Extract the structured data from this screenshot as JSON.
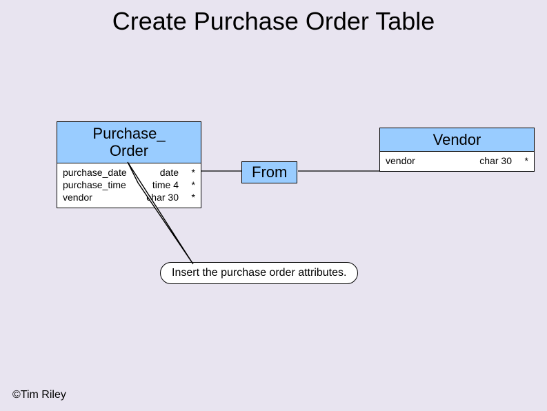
{
  "title": "Create Purchase Order Table",
  "entities": {
    "po": {
      "name": "Purchase_\nOrder",
      "attrs": [
        {
          "name": "purchase_date",
          "type": "date",
          "mark": "*"
        },
        {
          "name": "purchase_time",
          "type": "time 4",
          "mark": "*"
        },
        {
          "name": "vendor",
          "type": "char 30",
          "mark": "*"
        }
      ]
    },
    "vendor": {
      "name": "Vendor",
      "attrs": [
        {
          "name": "vendor",
          "type": "char 30",
          "mark": "*"
        }
      ]
    }
  },
  "relationship": {
    "label": "From"
  },
  "callout": "Insert the purchase order attributes.",
  "footer": "©Tim Riley"
}
